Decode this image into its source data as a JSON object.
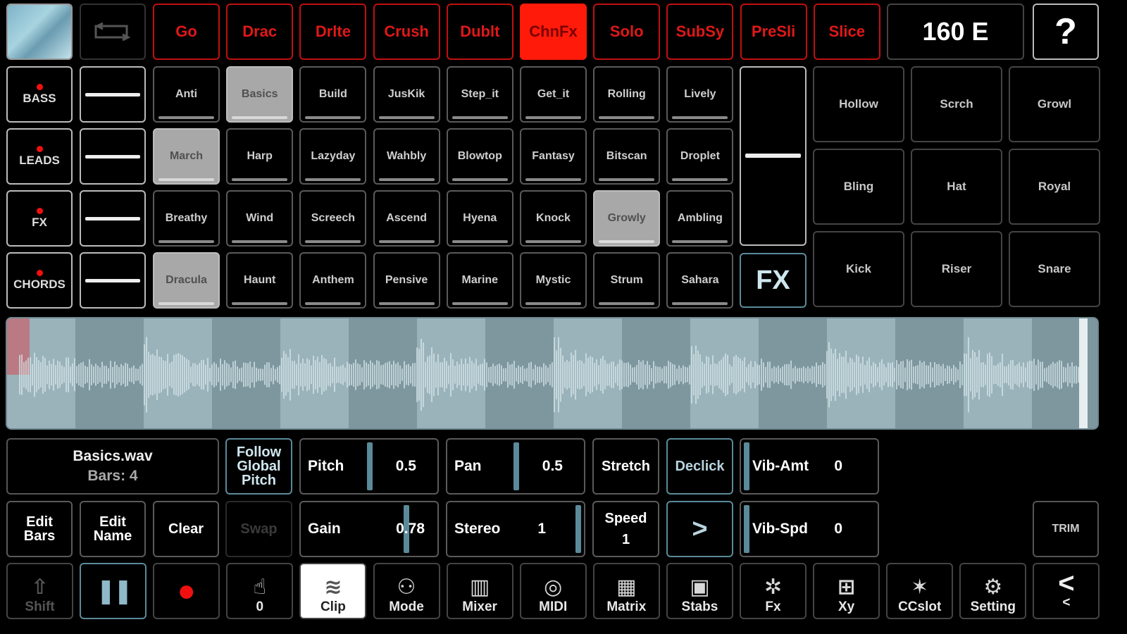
{
  "top_bar": {
    "fx_buttons": [
      {
        "label": "Go",
        "active": false
      },
      {
        "label": "Drac",
        "active": false
      },
      {
        "label": "Drlte",
        "active": false
      },
      {
        "label": "Crush",
        "active": false
      },
      {
        "label": "Dublt",
        "active": false
      },
      {
        "label": "ChnFx",
        "active": true
      },
      {
        "label": "Solo",
        "active": false
      },
      {
        "label": "SubSy",
        "active": false
      },
      {
        "label": "PreSli",
        "active": false
      },
      {
        "label": "Slice",
        "active": false
      }
    ],
    "tempo_display": "160 E",
    "help_label": "?"
  },
  "channels": [
    {
      "label": "BASS"
    },
    {
      "label": "LEADS"
    },
    {
      "label": "FX"
    },
    {
      "label": "CHORDS"
    }
  ],
  "clip_grid": [
    [
      "Anti",
      "Basics",
      "Build",
      "JusKik",
      "Step_it",
      "Get_it",
      "Rolling",
      "Lively"
    ],
    [
      "March",
      "Harp",
      "Lazyday",
      "Wahbly",
      "Blowtop",
      "Fantasy",
      "Bitscan",
      "Droplet"
    ],
    [
      "Breathy",
      "Wind",
      "Screech",
      "Ascend",
      "Hyena",
      "Knock",
      "Growly",
      "Ambling"
    ],
    [
      "Dracula",
      "Haunt",
      "Anthem",
      "Pensive",
      "Marine",
      "Mystic",
      "Strum",
      "Sahara"
    ]
  ],
  "fx_pad_label": "FX",
  "drum_pads": [
    [
      "Hollow",
      "Scrch",
      "Growl"
    ],
    [
      "Bling",
      "Hat",
      "Royal"
    ],
    [
      "Kick",
      "Riser",
      "Snare"
    ]
  ],
  "clip_info": {
    "filename": "Basics.wav",
    "bars": "Bars: 4"
  },
  "follow_global_pitch": [
    "Follow",
    "Global",
    "Pitch"
  ],
  "params": {
    "pitch": {
      "label": "Pitch",
      "value": "0.5"
    },
    "pan": {
      "label": "Pan",
      "value": "0.5"
    },
    "gain": {
      "label": "Gain",
      "value": "0.78"
    },
    "stereo": {
      "label": "Stereo",
      "value": "1"
    },
    "vib_amt": {
      "label": "Vib-Amt",
      "value": "0"
    },
    "vib_spd": {
      "label": "Vib-Spd",
      "value": "0"
    }
  },
  "buttons": {
    "stretch": "Stretch",
    "declick": "Declick",
    "speed_label": "Speed",
    "speed_value": "1",
    "next": ">",
    "edit_bars": [
      "Edit",
      "Bars"
    ],
    "edit_name": [
      "Edit",
      "Name"
    ],
    "clear": "Clear",
    "swap": "Swap",
    "trim": "TRIM"
  },
  "toolbar": [
    {
      "label": "Shift",
      "icon": "shift-arrow-icon"
    },
    {
      "label": "",
      "icon": "pause-icon"
    },
    {
      "label": "",
      "icon": "record-icon"
    },
    {
      "label": "0",
      "icon": "hand-icon"
    },
    {
      "label": "Clip",
      "icon": "waveform-icon"
    },
    {
      "label": "Mode",
      "icon": "mode-icon"
    },
    {
      "label": "Mixer",
      "icon": "mixer-icon"
    },
    {
      "label": "MIDI",
      "icon": "midi-icon"
    },
    {
      "label": "Matrix",
      "icon": "matrix-icon"
    },
    {
      "label": "Stabs",
      "icon": "stabs-icon"
    },
    {
      "label": "Fx",
      "icon": "fx-icon"
    },
    {
      "label": "Xy",
      "icon": "xy-icon"
    },
    {
      "label": "CCslot",
      "icon": "ccslot-icon"
    },
    {
      "label": "Setting",
      "icon": "gear-icon"
    },
    {
      "label": "<",
      "icon": "back-icon"
    }
  ],
  "colors": {
    "accent_red": "#e01818",
    "active_red": "#ff1a0a",
    "waveform_bg": "#8fa8b0",
    "blue_border": "#5b8a9a"
  }
}
